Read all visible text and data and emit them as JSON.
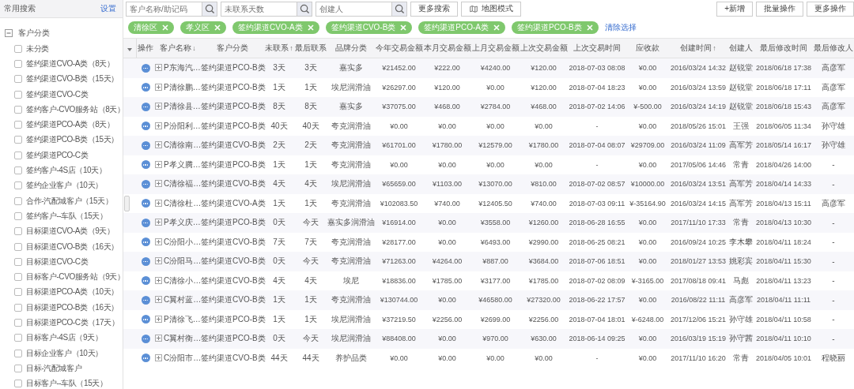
{
  "sidebar": {
    "title": "常用搜索",
    "settings_link": "设置",
    "tree": {
      "label": "客户分类",
      "expanded": true,
      "children": [
        {
          "label": "未分类",
          "checked": false
        },
        {
          "label": "签约渠道CVO-A类（8天）",
          "checked": false
        },
        {
          "label": "签约渠道CVO-B类（15天）",
          "checked": false
        },
        {
          "label": "签约渠道CVO-C类",
          "checked": false
        },
        {
          "label": "签约客户-CVO服务站（8天）",
          "checked": false
        },
        {
          "label": "签约渠道PCO-A类（8天）",
          "checked": false
        },
        {
          "label": "签约渠道PCO-B类（15天）",
          "checked": false
        },
        {
          "label": "签约渠道PCO-C类",
          "checked": false
        },
        {
          "label": "签约客户-4S店（10天）",
          "checked": false
        },
        {
          "label": "签约企业客户（10天）",
          "checked": false
        },
        {
          "label": "合作-汽配城客户（15天）",
          "checked": false
        },
        {
          "label": "签约客户--车队（15天）",
          "checked": false
        },
        {
          "label": "目标渠道CVO-A类（9天）",
          "checked": false
        },
        {
          "label": "目标渠道CVO-B类（16天）",
          "checked": false
        },
        {
          "label": "目标渠道CVO-C类",
          "checked": false
        },
        {
          "label": "目标客户-CVO服务站（9天）",
          "checked": false
        },
        {
          "label": "目标渠道PCO-A类（10天）",
          "checked": false
        },
        {
          "label": "目标渠道PCO-B类（16天）",
          "checked": false
        },
        {
          "label": "目标渠道PCO-C类（17天）",
          "checked": false
        },
        {
          "label": "目标客户-4S店（9天）",
          "checked": false
        },
        {
          "label": "目标企业客户（10天）",
          "checked": false
        },
        {
          "label": "目标-汽配城客户",
          "checked": false
        },
        {
          "label": "目标客户--车队（15天）",
          "checked": false
        }
      ]
    }
  },
  "toolbar": {
    "search_fields": [
      {
        "placeholder": "客户名称/助记码"
      },
      {
        "placeholder": "未联系天数"
      },
      {
        "placeholder": "创建人"
      }
    ],
    "more_search": "更多搜索",
    "map_mode": "地图模式",
    "actions": [
      "+新增",
      "批量操作",
      "更多操作"
    ]
  },
  "filters": {
    "tags": [
      "清徐区",
      "孝义区",
      "签约渠道CVO-A类",
      "签约渠道CVO-B类",
      "签约渠道PCO-A类",
      "签约渠道PCO-B类"
    ],
    "clear": "清除选择"
  },
  "table": {
    "action_column": "操作",
    "columns": [
      {
        "label": "客户名称",
        "arrow": "↓"
      },
      {
        "label": "客户分类"
      },
      {
        "label": "未联系",
        "arrow": "↑"
      },
      {
        "label": "最后联系"
      },
      {
        "label": "品牌分类"
      },
      {
        "label": "今年交易金额"
      },
      {
        "label": "本月交易金额"
      },
      {
        "label": "上月交易金额"
      },
      {
        "label": "上次交易金额"
      },
      {
        "label": "上次交易时间"
      },
      {
        "label": "应收款"
      },
      {
        "label": "创建时间",
        "arrow": "↑"
      },
      {
        "label": "创建人"
      },
      {
        "label": "最后修改时间"
      },
      {
        "label": "最后修改人"
      }
    ],
    "rows": [
      [
        "P东海汽…",
        "签约渠道PCO-B类",
        "3天",
        "3天",
        "嘉实多",
        "¥21452.00",
        "¥222.00",
        "¥4240.00",
        "¥120.00",
        "2018-07-03 08:08",
        "¥0.00",
        "2016/03/24 14:32",
        "赵锐堂",
        "2018/06/18 17:38",
        "高彦军"
      ],
      [
        "P清徐鹏…",
        "签约渠道PCO-B类",
        "1天",
        "1天",
        "埃尼润滑油",
        "¥26297.00",
        "¥120.00",
        "¥0.00",
        "¥120.00",
        "2018-07-04 18:23",
        "¥0.00",
        "2016/03/24 13:59",
        "赵锐堂",
        "2018/06/18 17:11",
        "高彦军"
      ],
      [
        "P清徐县…",
        "签约渠道PCO-B类",
        "8天",
        "8天",
        "嘉实多",
        "¥37075.00",
        "¥468.00",
        "¥2784.00",
        "¥468.00",
        "2018-07-02 14:06",
        "¥-500.00",
        "2016/03/24 14:19",
        "赵锐堂",
        "2018/06/18 15:43",
        "高彦军"
      ],
      [
        "P汾阳利…",
        "签约渠道PCO-B类",
        "40天",
        "40天",
        "夸克润滑油",
        "¥0.00",
        "¥0.00",
        "¥0.00",
        "¥0.00",
        "-",
        "¥0.00",
        "2018/05/26 15:01",
        "王强",
        "2018/06/05 11:34",
        "孙守雄"
      ],
      [
        "C清徐南…",
        "签约渠道CVO-B类",
        "2天",
        "2天",
        "夸克润滑油",
        "¥61701.00",
        "¥1780.00",
        "¥12579.00",
        "¥1780.00",
        "2018-07-04 08:07",
        "¥29709.00",
        "2016/03/24 11:09",
        "高军芳",
        "2018/05/14 16:17",
        "孙守雄"
      ],
      [
        "P孝义腾…",
        "签约渠道PCO-B类",
        "1天",
        "1天",
        "夸克润滑油",
        "¥0.00",
        "¥0.00",
        "¥0.00",
        "¥0.00",
        "-",
        "¥0.00",
        "2017/05/06 14:46",
        "常青",
        "2018/04/26 14:00",
        "-"
      ],
      [
        "C清徐福…",
        "签约渠道CVO-B类",
        "4天",
        "4天",
        "埃尼润滑油",
        "¥65659.00",
        "¥1103.00",
        "¥13070.00",
        "¥810.00",
        "2018-07-02 08:57",
        "¥10000.00",
        "2016/03/24 13:51",
        "高军芳",
        "2018/04/14 14:33",
        "-"
      ],
      [
        "C清徐杜…",
        "签约渠道CVO-A类",
        "1天",
        "1天",
        "夸克润滑油",
        "¥102083.50",
        "¥740.00",
        "¥12405.50",
        "¥740.00",
        "2018-07-03 09:11",
        "¥-35164.90",
        "2016/03/24 14:15",
        "高军芳",
        "2018/04/13 15:11",
        "高彦军"
      ],
      [
        "P孝义庆…",
        "签约渠道PCO-B类",
        "0天",
        "今天",
        "嘉实多润滑油",
        "¥16914.00",
        "¥0.00",
        "¥3558.00",
        "¥1260.00",
        "2018-06-28 16:55",
        "¥0.00",
        "2017/11/10 17:33",
        "常青",
        "2018/04/13 10:30",
        "-"
      ],
      [
        "C汾阳小…",
        "签约渠道CVO-B类",
        "7天",
        "7天",
        "夸克润滑油",
        "¥28177.00",
        "¥0.00",
        "¥6493.00",
        "¥2990.00",
        "2018-06-25 08:21",
        "¥0.00",
        "2016/09/24 10:25",
        "李木攀",
        "2018/04/11 18:24",
        "-"
      ],
      [
        "C汾阳马…",
        "签约渠道CVO-B类",
        "0天",
        "今天",
        "夸克润滑油",
        "¥71263.00",
        "¥4264.00",
        "¥887.00",
        "¥3684.00",
        "2018-07-06 18:51",
        "¥0.00",
        "2018/01/27 13:53",
        "姚彩宾",
        "2018/04/11 15:30",
        "-"
      ],
      [
        "C清徐小…",
        "签约渠道CVO-B类",
        "4天",
        "4天",
        "埃尼",
        "¥18836.00",
        "¥1785.00",
        "¥3177.00",
        "¥1785.00",
        "2018-07-02 08:09",
        "¥-3165.00",
        "2017/08/18 09:41",
        "马彪",
        "2018/04/11 13:23",
        "-"
      ],
      [
        "C翼村蓝…",
        "签约渠道CVO-B类",
        "1天",
        "1天",
        "夸克润滑油",
        "¥130744.00",
        "¥0.00",
        "¥46580.00",
        "¥27320.00",
        "2018-06-22 17:57",
        "¥0.00",
        "2016/08/22 11:11",
        "高彦军",
        "2018/04/11 11:11",
        "-"
      ],
      [
        "P清徐飞…",
        "签约渠道PCO-B类",
        "1天",
        "1天",
        "埃尼润滑油",
        "¥37219.50",
        "¥2256.00",
        "¥2699.00",
        "¥2256.00",
        "2018-07-04 18:01",
        "¥-6248.00",
        "2017/12/06 15:21",
        "孙守雄",
        "2018/04/11 10:58",
        "-"
      ],
      [
        "C翼村衡…",
        "签约渠道PCO-B类",
        "0天",
        "今天",
        "埃尼润滑油",
        "¥88408.00",
        "¥0.00",
        "¥970.00",
        "¥630.00",
        "2018-06-14 09:25",
        "¥0.00",
        "2016/03/19 15:19",
        "孙守茜",
        "2018/04/11 10:10",
        "-"
      ],
      [
        "C汾阳市…",
        "签约渠道CVO-B类",
        "44天",
        "44天",
        "养护品类",
        "¥0.00",
        "¥0.00",
        "¥0.00",
        "¥0.00",
        "-",
        "¥0.00",
        "2017/11/10 16:20",
        "常青",
        "2018/04/05 10:01",
        "程晓丽"
      ]
    ]
  }
}
